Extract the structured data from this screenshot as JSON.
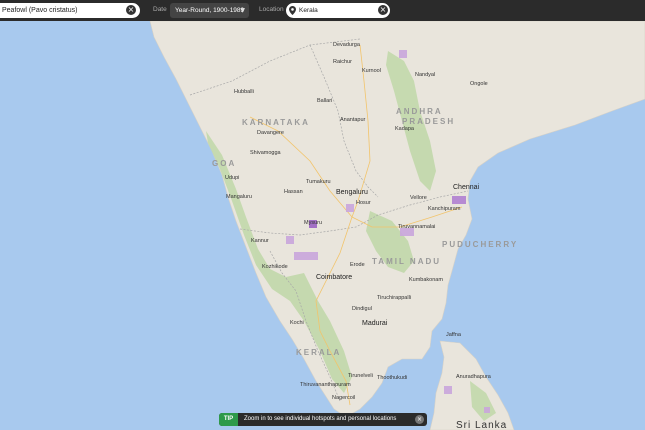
{
  "search": {
    "species_value": "Peafowl (Pavo cristatus)",
    "dates_label": "Date",
    "dates_value": "Year-Round, 1900-1989",
    "location_label": "Location",
    "location_value": "Kerala"
  },
  "map": {
    "regions": {
      "karnataka": "KARNATAKA",
      "andhra1": "ANDHRA",
      "andhra2": "PRADESH",
      "goa": "GOA",
      "tamilnadu": "TAMIL NADU",
      "puducherry": "PUDUCHERRY",
      "kerala": "KERALA"
    },
    "cities": {
      "devadurga": "Devadurga",
      "raichur": "Raichur",
      "kurnool": "Kurnool",
      "nandyal": "Nandyal",
      "ongole": "Ongole",
      "hubballi": "Hubballi",
      "ballari": "Ballari",
      "anantapur": "Anantapur",
      "kadapa": "Kadapa",
      "davangere": "Davangere",
      "shivamogga": "Shivamogga",
      "udupi": "Udupi",
      "hassan": "Hassan",
      "tumakuru": "Tumakuru",
      "mangaluru": "Mangaluru",
      "bengaluru": "Bengaluru",
      "hosur": "Hosur",
      "vellore": "Vellore",
      "chennai": "Chennai",
      "kanchipuram": "Kanchipuram",
      "mysuru": "Mysuru",
      "tiruvannamalai": "Tiruvannamalai",
      "kannur": "Kannur",
      "kozhikode": "Kozhikode",
      "coimbatore": "Coimbatore",
      "erode": "Erode",
      "kumbakonam": "Kumbakonam",
      "tiruchirappalli": "Tiruchirappalli",
      "kochi": "Kochi",
      "dindigul": "Dindigul",
      "madurai": "Madurai",
      "jaffna": "Jaffna",
      "thiruvananthapuram": "Thiruvananthapuram",
      "tirunelveli": "Tirunelveli",
      "thoothukudi": "Thoothukudi",
      "nagercoil": "Nagercoil",
      "anuradhapura": "Anuradhapura",
      "srilanka": "Sri Lanka"
    }
  },
  "tip": {
    "badge": "TIP",
    "text": "Zoom in to see individual hotspots and personal locations"
  }
}
